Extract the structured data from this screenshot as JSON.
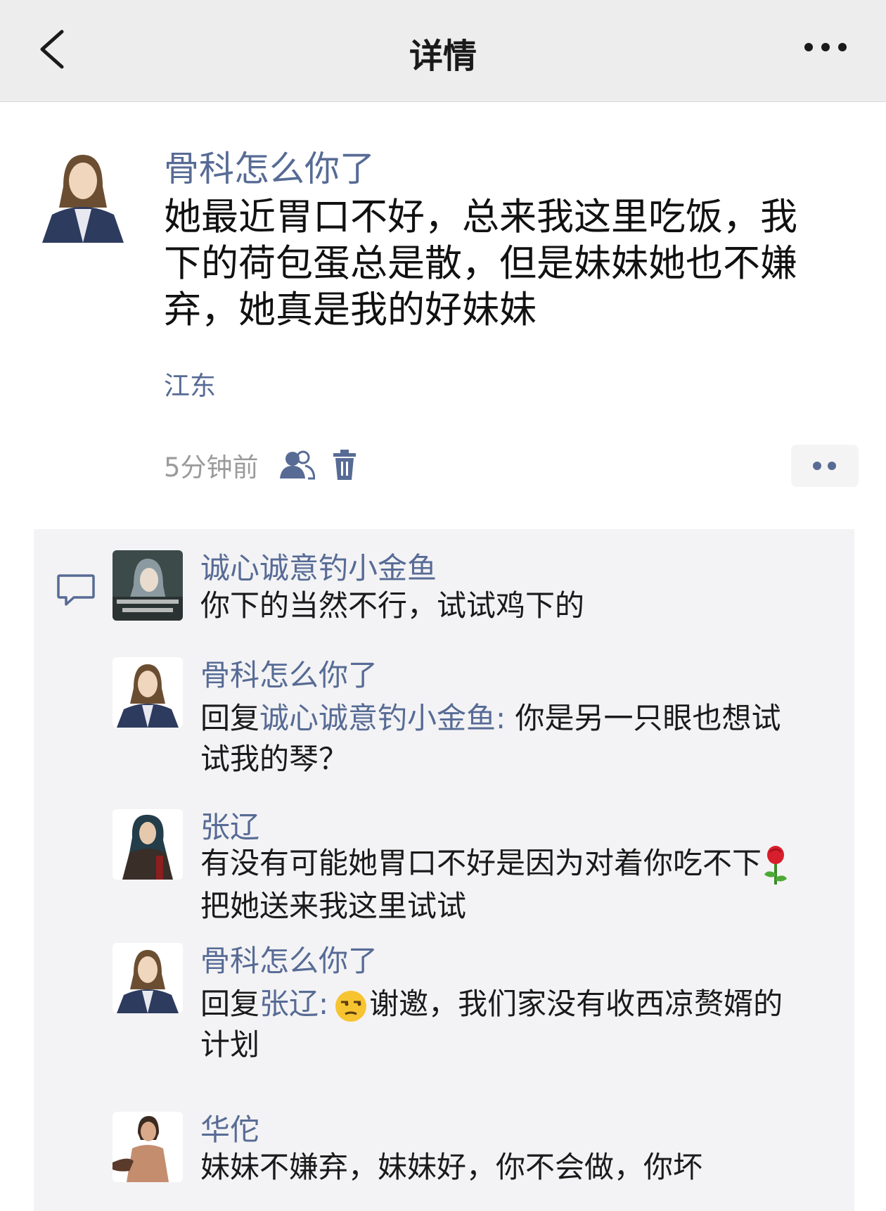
{
  "nav": {
    "title": "详情",
    "back_icon": "chevron-left-icon",
    "more_icon": "more-dots-icon"
  },
  "post": {
    "author": "骨科怎么你了",
    "text": "她最近胃口不好，总来我这里吃饭，我下的荷包蛋总是散，但是妹妹她也不嫌弃，她真是我的好妹妹",
    "location": "江东",
    "time": "5分钟前",
    "icons": [
      "friends-visibility-icon",
      "trash-icon"
    ]
  },
  "comments": [
    {
      "name": "诚心诚意钓小金鱼",
      "text": "你下的当然不行，试试鸡下的"
    },
    {
      "name": "骨科怎么你了",
      "reply_prefix": "回复",
      "reply_to": "诚心诚意钓小金鱼:",
      "text": " 你是另一只眼也想试试我的琴？"
    },
    {
      "name": "张辽",
      "text_before": "有没有可能她胃口不好是因为对着你吃不下",
      "emoji": "rose-emoji",
      "text_after": " 把她送来我这里试试"
    },
    {
      "name": "骨科怎么你了",
      "reply_prefix": "回复",
      "reply_to": "张辽:",
      "emoji": "unamused-face-emoji",
      "text": "谢邀，我们家没有收西凉赘婿的计划"
    },
    {
      "name": "华佗",
      "text": "妹妹不嫌弃，妹妹好，你不会做，你坏"
    }
  ],
  "colors": {
    "link": "#576b95",
    "navbar": "#ededed",
    "comments_bg": "#f3f3f5"
  }
}
